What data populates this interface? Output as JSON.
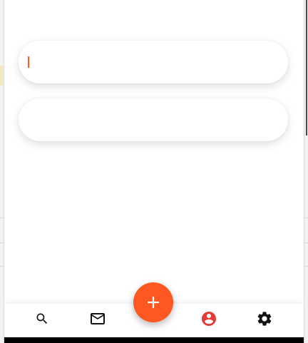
{
  "theme": {
    "accent": "#ff5722",
    "profile_icon_color": "#e53935",
    "icon_color": "#111111"
  },
  "form": {
    "field_1": {
      "value": "",
      "focused": true
    },
    "field_2": {
      "value": "",
      "focused": false
    }
  },
  "fab": {
    "icon": "plus-icon"
  },
  "bottom_nav": {
    "items": [
      {
        "icon": "search-icon"
      },
      {
        "icon": "mail-icon"
      },
      {
        "icon": "account-circle-icon",
        "active": true
      },
      {
        "icon": "gear-icon"
      }
    ]
  }
}
